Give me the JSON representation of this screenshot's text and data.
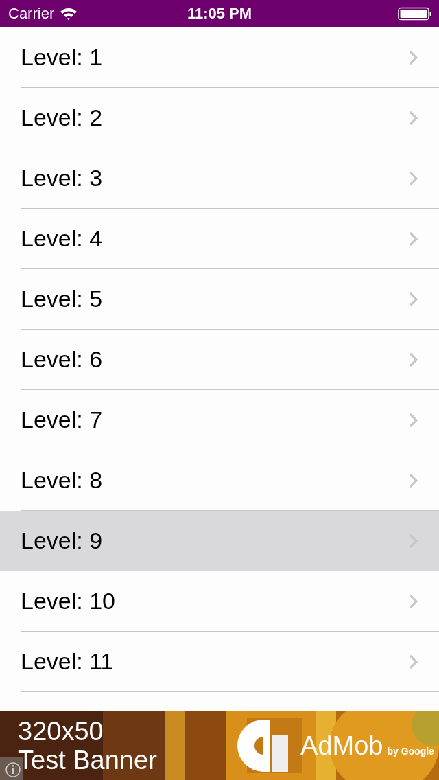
{
  "status_bar": {
    "carrier": "Carrier",
    "time": "11:05 PM"
  },
  "levels": [
    {
      "label": "Level: 1",
      "selected": false
    },
    {
      "label": "Level: 2",
      "selected": false
    },
    {
      "label": "Level: 3",
      "selected": false
    },
    {
      "label": "Level: 4",
      "selected": false
    },
    {
      "label": "Level: 5",
      "selected": false
    },
    {
      "label": "Level: 6",
      "selected": false
    },
    {
      "label": "Level: 7",
      "selected": false
    },
    {
      "label": "Level: 8",
      "selected": false
    },
    {
      "label": "Level: 9",
      "selected": true
    },
    {
      "label": "Level: 10",
      "selected": false
    },
    {
      "label": "Level: 11",
      "selected": false
    }
  ],
  "ad_banner": {
    "size": "320x50",
    "title": "Test Banner",
    "brand": "AdMob",
    "byline": "by Google"
  }
}
